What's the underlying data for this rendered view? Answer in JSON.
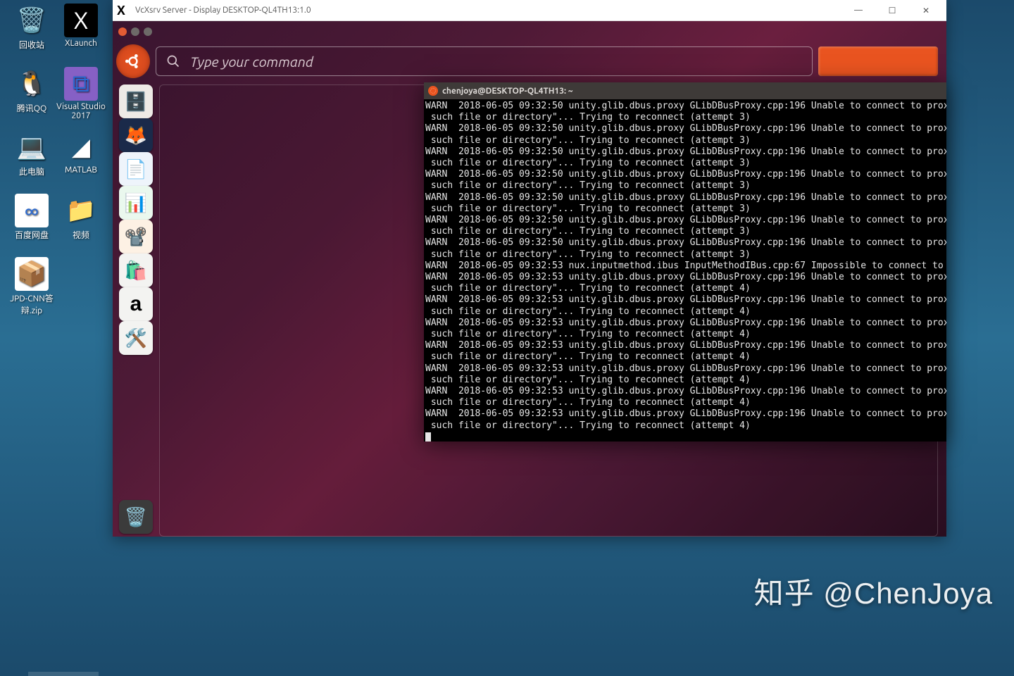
{
  "desktop": {
    "icons_col1": [
      {
        "name": "recycle-bin",
        "label": "回收站",
        "glyph": "🗑️",
        "bg": "transparent"
      },
      {
        "name": "tencent-qq",
        "label": "腾讯QQ",
        "glyph": "🐧",
        "bg": "transparent"
      },
      {
        "name": "this-pc",
        "label": "此电脑",
        "glyph": "💻",
        "bg": "transparent"
      },
      {
        "name": "baidu-netdisk",
        "label": "百度网盘",
        "glyph": "∞",
        "bg": "#fff"
      },
      {
        "name": "jpd-cnn-zip",
        "label": "JPD-CNN答辩.zip",
        "glyph": "📦",
        "bg": "#fff"
      }
    ],
    "icons_col2": [
      {
        "name": "xlaunch",
        "label": "XLaunch",
        "glyph": "X",
        "bg": "#000"
      },
      {
        "name": "visual-studio",
        "label": "Visual Studio 2017",
        "glyph": "⧉",
        "bg": "#8660c5"
      },
      {
        "name": "matlab",
        "label": "MATLAB",
        "glyph": "◢",
        "bg": "transparent"
      },
      {
        "name": "video-folder",
        "label": "视频",
        "glyph": "📁",
        "bg": "transparent"
      }
    ]
  },
  "xwin": {
    "title": "VcXsrv Server - Display DESKTOP-QL4TH13:1.0",
    "controls": {
      "min": "—",
      "max": "☐",
      "close": "✕"
    }
  },
  "hud": {
    "placeholder": "Type your command"
  },
  "launcher": [
    {
      "name": "files",
      "glyph": "🗄️",
      "bg": "#eeeae6"
    },
    {
      "name": "firefox",
      "glyph": "🦊",
      "bg": "#1a2a4a"
    },
    {
      "name": "writer",
      "glyph": "📄",
      "bg": "#eef4fb"
    },
    {
      "name": "calc",
      "glyph": "📊",
      "bg": "#eaf8ee"
    },
    {
      "name": "impress",
      "glyph": "📽️",
      "bg": "#fdf1e4"
    },
    {
      "name": "software",
      "glyph": "🛍️",
      "bg": "#f3f3f1"
    },
    {
      "name": "amazon",
      "glyph": "a",
      "bg": "#f3f3f1"
    },
    {
      "name": "settings",
      "glyph": "🛠️",
      "bg": "#f3f3f1"
    }
  ],
  "trash": {
    "name": "trash",
    "glyph": "🗑️",
    "bg": "#3b3b3b"
  },
  "terminal": {
    "title": "chenjoya@DESKTOP-QL4TH13: ~",
    "lines": [
      "WARN  2018-06-05 09:32:50 unity.glib.dbus.proxy GLibDBusProxy.cpp:196 Unable to connect to prox",
      " such file or directory\"... Trying to reconnect (attempt 3)",
      "WARN  2018-06-05 09:32:50 unity.glib.dbus.proxy GLibDBusProxy.cpp:196 Unable to connect to prox",
      " such file or directory\"... Trying to reconnect (attempt 3)",
      "WARN  2018-06-05 09:32:50 unity.glib.dbus.proxy GLibDBusProxy.cpp:196 Unable to connect to prox",
      " such file or directory\"... Trying to reconnect (attempt 3)",
      "WARN  2018-06-05 09:32:50 unity.glib.dbus.proxy GLibDBusProxy.cpp:196 Unable to connect to prox",
      " such file or directory\"... Trying to reconnect (attempt 3)",
      "WARN  2018-06-05 09:32:50 unity.glib.dbus.proxy GLibDBusProxy.cpp:196 Unable to connect to prox",
      " such file or directory\"... Trying to reconnect (attempt 3)",
      "WARN  2018-06-05 09:32:50 unity.glib.dbus.proxy GLibDBusProxy.cpp:196 Unable to connect to prox",
      " such file or directory\"... Trying to reconnect (attempt 3)",
      "WARN  2018-06-05 09:32:50 unity.glib.dbus.proxy GLibDBusProxy.cpp:196 Unable to connect to prox",
      " such file or directory\"... Trying to reconnect (attempt 3)",
      "WARN  2018-06-05 09:32:53 nux.inputmethod.ibus InputMethodIBus.cpp:67 Impossible to connect to",
      "WARN  2018-06-05 09:32:53 unity.glib.dbus.proxy GLibDBusProxy.cpp:196 Unable to connect to prox",
      " such file or directory\"... Trying to reconnect (attempt 4)",
      "WARN  2018-06-05 09:32:53 unity.glib.dbus.proxy GLibDBusProxy.cpp:196 Unable to connect to prox",
      " such file or directory\"... Trying to reconnect (attempt 4)",
      "WARN  2018-06-05 09:32:53 unity.glib.dbus.proxy GLibDBusProxy.cpp:196 Unable to connect to prox",
      " such file or directory\"... Trying to reconnect (attempt 4)",
      "WARN  2018-06-05 09:32:53 unity.glib.dbus.proxy GLibDBusProxy.cpp:196 Unable to connect to prox",
      " such file or directory\"... Trying to reconnect (attempt 4)",
      "WARN  2018-06-05 09:32:53 unity.glib.dbus.proxy GLibDBusProxy.cpp:196 Unable to connect to prox",
      " such file or directory\"... Trying to reconnect (attempt 4)",
      "WARN  2018-06-05 09:32:53 unity.glib.dbus.proxy GLibDBusProxy.cpp:196 Unable to connect to prox",
      " such file or directory\"... Trying to reconnect (attempt 4)",
      "WARN  2018-06-05 09:32:53 unity.glib.dbus.proxy GLibDBusProxy.cpp:196 Unable to connect to prox",
      " such file or directory\"... Trying to reconnect (attempt 4)"
    ]
  },
  "watermark": "知乎 @ChenJoya",
  "colors": {
    "ubuntu_orange": "#e95420",
    "traffic_close": "#e25c34",
    "traffic_min": "#6d6a68",
    "traffic_max": "#6d6a68"
  }
}
